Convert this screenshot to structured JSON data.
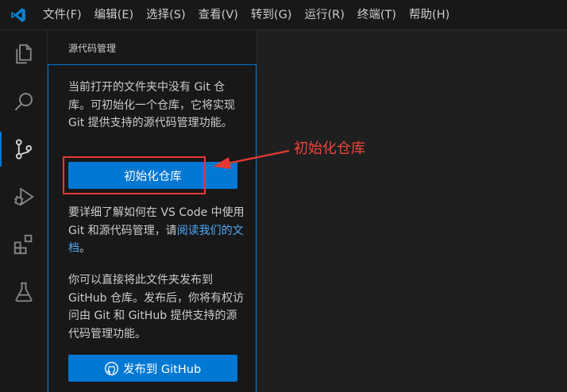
{
  "menu": {
    "items": [
      "文件(F)",
      "编辑(E)",
      "选择(S)",
      "查看(V)",
      "转到(G)",
      "运行(R)",
      "终端(T)",
      "帮助(H)"
    ]
  },
  "activity_bar": {
    "icons": [
      "explorer-icon",
      "search-icon",
      "source-control-icon",
      "run-debug-icon",
      "extensions-icon",
      "testing-icon"
    ],
    "active": "source-control-icon"
  },
  "sidebar": {
    "title": "源代码管理",
    "intro_text": "当前打开的文件夹中没有 Git 仓库。可初始化一个仓库，它将实现 Git 提供支持的源代码管理功能。",
    "init_button_label": "初始化仓库",
    "learn_text": "要详细了解如何在 VS Code 中使用 Git 和源代码管理，请",
    "learn_link": "阅读我们的文档",
    "learn_suffix": "。",
    "publish_text": "你可以直接将此文件夹发布到 GitHub 仓库。发布后，你将有权访问由 Git 和 GitHub 提供支持的源代码管理功能。",
    "publish_button_label": "发布到 GitHub"
  },
  "annotation": {
    "label": "初始化仓库",
    "color": "#e53935"
  },
  "colors": {
    "accent": "#0078d4",
    "link": "#4daafc",
    "background": "#1f1f1f",
    "panel": "#181818"
  }
}
